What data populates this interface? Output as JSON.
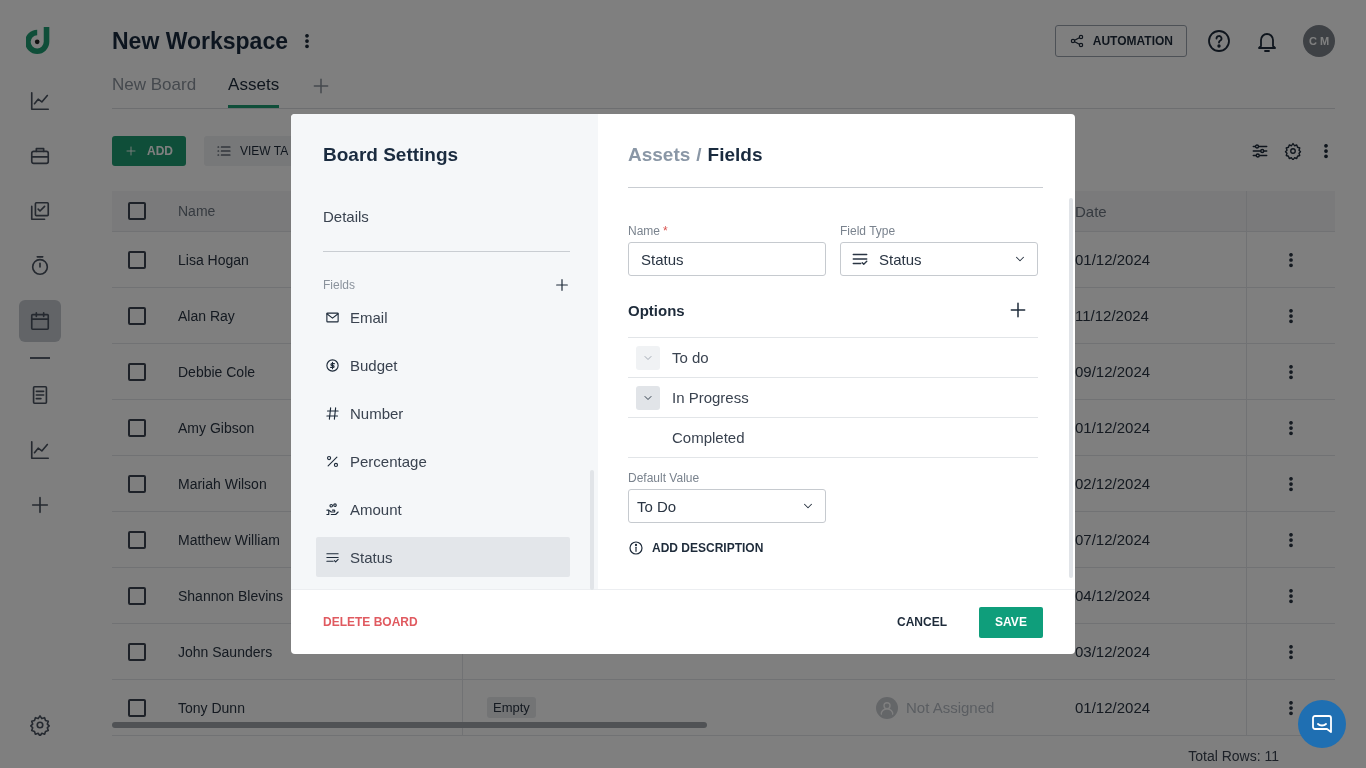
{
  "sidebar": {
    "items": [
      {
        "kind": "chart",
        "selected": false
      },
      {
        "kind": "briefcase",
        "selected": false
      },
      {
        "kind": "tasks",
        "selected": false
      },
      {
        "kind": "timer",
        "selected": false
      },
      {
        "kind": "calendar",
        "selected": true
      },
      {
        "kind": "document",
        "selected": false
      },
      {
        "kind": "chart",
        "selected": false
      },
      {
        "kind": "plus",
        "selected": false
      }
    ]
  },
  "header": {
    "title": "New Workspace",
    "automation_button": "AUTOMATION",
    "avatar_initials": "C M"
  },
  "tabs": [
    {
      "label": "New Board",
      "selected": false
    },
    {
      "label": "Assets",
      "selected": true
    }
  ],
  "toolbar": {
    "add_button": "ADD",
    "view_button": "VIEW TA"
  },
  "table": {
    "columns": [
      "Name",
      "Date"
    ],
    "all_checked": false,
    "rows": [
      {
        "name": "Lisa Hogan",
        "checked": false,
        "date": "01/12/2024"
      },
      {
        "name": "Alan Ray",
        "checked": false,
        "date": "11/12/2024"
      },
      {
        "name": "Debbie Cole",
        "checked": false,
        "date": "09/12/2024"
      },
      {
        "name": "Amy Gibson",
        "checked": false,
        "date": "01/12/2024"
      },
      {
        "name": "Mariah Wilson",
        "checked": false,
        "date": "02/12/2024"
      },
      {
        "name": "Matthew William",
        "checked": false,
        "date": "07/12/2024"
      },
      {
        "name": "Shannon Blevins",
        "checked": false,
        "date": "04/12/2024"
      },
      {
        "name": "John Saunders",
        "checked": false,
        "date": "03/12/2024"
      },
      {
        "name": "Tony Dunn",
        "checked": false,
        "tag": "Empty",
        "assignee": "Not Assigned",
        "date": "01/12/2024"
      }
    ]
  },
  "total_rows": "Total Rows: 11",
  "dialog": {
    "title": "Board Settings",
    "nav_item": "Details",
    "fields_label": "Fields",
    "fields": [
      {
        "label": "Email",
        "kind": "email",
        "selected": false
      },
      {
        "label": "Budget",
        "kind": "budget",
        "selected": false
      },
      {
        "label": "Number",
        "kind": "number",
        "selected": false
      },
      {
        "label": "Percentage",
        "kind": "percentage",
        "selected": false
      },
      {
        "label": "Amount",
        "kind": "amount",
        "selected": false
      },
      {
        "label": "Status",
        "kind": "status",
        "selected": true
      }
    ],
    "breadcrumb": {
      "parent": "Assets",
      "separator": "/",
      "current": "Fields"
    },
    "name_label": "Name",
    "required_mark": "*",
    "name_value": "Status",
    "field_type_label": "Field Type",
    "field_type_value": "Status",
    "options_label": "Options",
    "options": [
      {
        "label": "To do",
        "toggle_visible": true,
        "active": false
      },
      {
        "label": "In Progress",
        "toggle_visible": true,
        "active": true
      },
      {
        "label": "Completed",
        "toggle_visible": false
      }
    ],
    "default_label": "Default Value",
    "default_value": "To Do",
    "add_description": "ADD DESCRIPTION",
    "delete_button": "DELETE BOARD",
    "cancel_button": "CANCEL",
    "save_button": "SAVE"
  }
}
